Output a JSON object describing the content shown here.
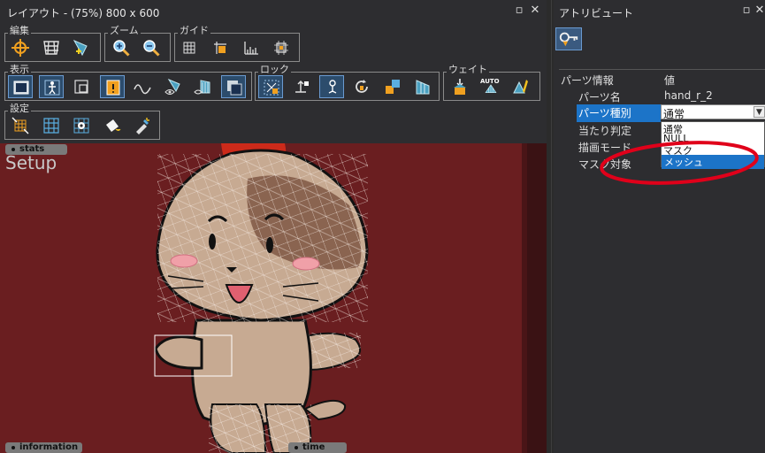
{
  "layout_panel": {
    "title": "レイアウト - (75%) 800 x 600",
    "pin_icon": "pin-icon",
    "close_icon": "close-icon",
    "groups": {
      "edit": "編集",
      "zoom": "ズーム",
      "guide": "ガイド",
      "display": "表示",
      "lock": "ロック",
      "weight": "ウェイト",
      "settings": "設定"
    },
    "weight_auto_label": "AUTO"
  },
  "canvas": {
    "stats_tag": "stats",
    "setup_text": "Setup",
    "information_tag": "information",
    "time_tag": "time",
    "background_color": "#6a1e20"
  },
  "attribute_panel": {
    "title": "アトリビュート",
    "table": {
      "header_key": "パーツ情報",
      "header_value": "値",
      "rows": [
        {
          "key": "パーツ名",
          "value": "hand_r_2"
        },
        {
          "key": "パーツ種別",
          "value": "通常"
        },
        {
          "key": "当たり判定",
          "value": ""
        },
        {
          "key": "描画モード",
          "value": ""
        },
        {
          "key": "マスク対象",
          "value": ""
        }
      ]
    },
    "dropdown_options": [
      "通常",
      "NULL",
      "マスク",
      "メッシュ"
    ],
    "dropdown_selected": "メッシュ"
  },
  "colors": {
    "accent": "#1c74c8",
    "annotation_red": "#e0001a"
  }
}
